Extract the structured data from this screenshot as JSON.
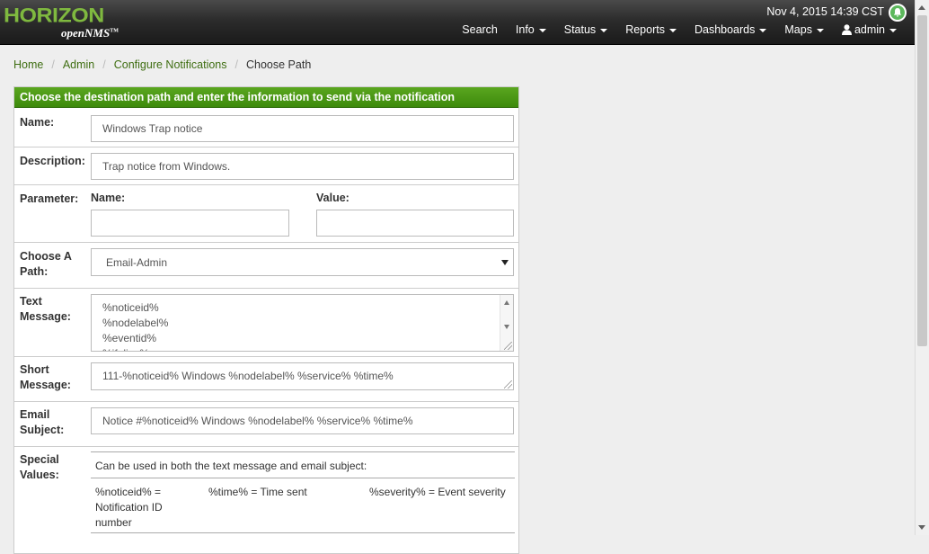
{
  "brand": {
    "logo_text": "HORIZON",
    "logo_sub": "openNMS"
  },
  "header": {
    "datetime": "Nov 4, 2015 14:39 CST",
    "nav": [
      "Search",
      "Info",
      "Status",
      "Reports",
      "Dashboards",
      "Maps",
      "admin"
    ]
  },
  "breadcrumb": {
    "items": [
      "Home",
      "Admin",
      "Configure Notifications"
    ],
    "current": "Choose Path"
  },
  "panel": {
    "title": "Choose the destination path and enter the information to send via the notification",
    "name_label": "Name:",
    "name_value": "Windows Trap notice",
    "description_label": "Description:",
    "description_value": "Trap notice from Windows.",
    "parameter_label": "Parameter:",
    "param_name_label": "Name:",
    "param_value_label": "Value:",
    "param_name_value": "",
    "param_value_value": "",
    "path_label_1": "Choose A",
    "path_label_2": "Path:",
    "path_selected": "Email-Admin",
    "text_message_label_1": "Text",
    "text_message_label_2": "Message:",
    "text_message_lines": [
      "%noticeid%",
      "%nodelabel%",
      "%eventid%",
      "%ifalias%"
    ],
    "short_message_label_1": "Short",
    "short_message_label_2": "Message:",
    "short_message_value": "111-%noticeid% Windows %nodelabel% %service% %time%",
    "email_subject_label_1": "Email",
    "email_subject_label_2": "Subject:",
    "email_subject_value": "Notice #%noticeid% Windows %nodelabel% %service% %time%",
    "special_values_label_1": "Special",
    "special_values_label_2": "Values:",
    "special_values_intro": "Can be used in both the text message and email subject:",
    "special_values": [
      "%noticeid% = Notification ID number",
      "%time% = Time sent",
      "%severity% = Event severity"
    ]
  }
}
